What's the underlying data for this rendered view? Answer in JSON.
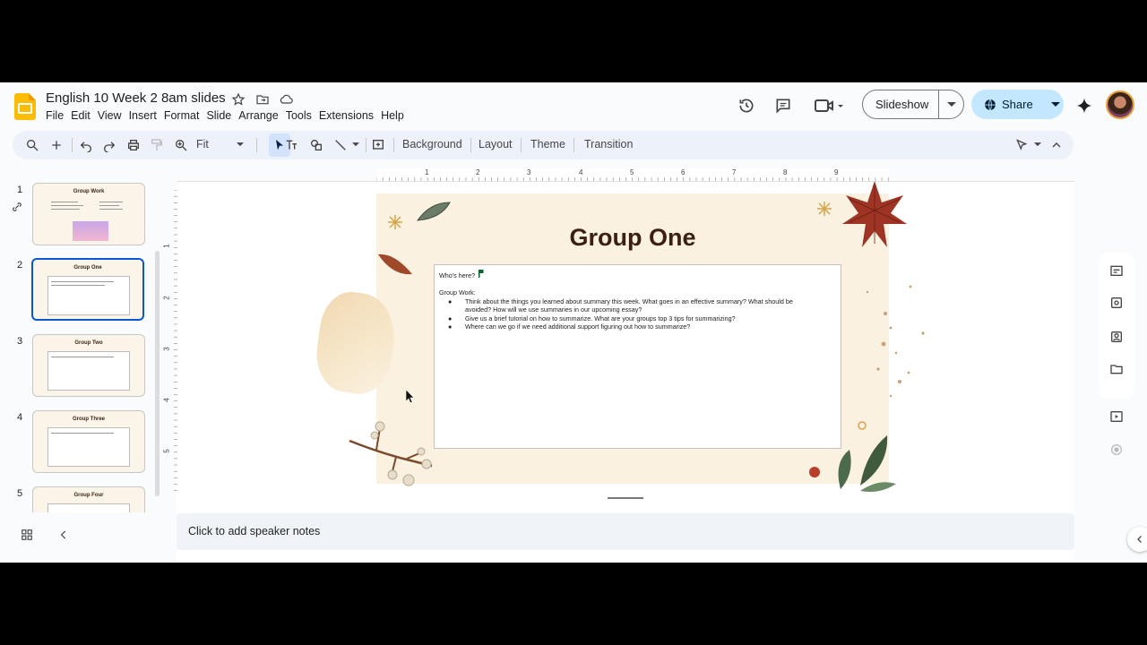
{
  "app": {
    "doc_title": "English 10 Week 2 8am slides",
    "menu": [
      "File",
      "Edit",
      "View",
      "Insert",
      "Format",
      "Slide",
      "Arrange",
      "Tools",
      "Extensions",
      "Help"
    ],
    "slideshow_label": "Slideshow",
    "share_label": "Share"
  },
  "toolbar": {
    "zoom_label": "Fit",
    "background_label": "Background",
    "layout_label": "Layout",
    "theme_label": "Theme",
    "transition_label": "Transition"
  },
  "filmstrip": {
    "slides": [
      {
        "num": "1",
        "title": "Group Work"
      },
      {
        "num": "2",
        "title": "Group One"
      },
      {
        "num": "3",
        "title": "Group Two"
      },
      {
        "num": "4",
        "title": "Group Three"
      },
      {
        "num": "5",
        "title": "Group Four"
      }
    ],
    "selected": 2
  },
  "ruler": {
    "h": [
      "1",
      "2",
      "3",
      "4",
      "5",
      "6",
      "7",
      "8",
      "9"
    ],
    "v": [
      "1",
      "2",
      "3",
      "4",
      "5"
    ]
  },
  "slide": {
    "title": "Group One",
    "line1": "Who's here?",
    "line2": "Group Work:",
    "bullets": [
      "Think about the things you learned about summary this week. What goes in an effective summary? What should be",
      "avoided? How will we use summaries in our upcoming essay?",
      "Give us a brief tutorial on how to summarize. What are your groups top 3 tips for summarizing?",
      "Where can we go if we need additional support figuring out how to summarize?"
    ]
  },
  "notes": {
    "placeholder": "Click to add speaker notes"
  },
  "colors": {
    "accent": "#0b57d0",
    "share_bg": "#c2e7ff",
    "toolbar_bg": "#edf2fa",
    "slide_title": "#3b1f12"
  }
}
